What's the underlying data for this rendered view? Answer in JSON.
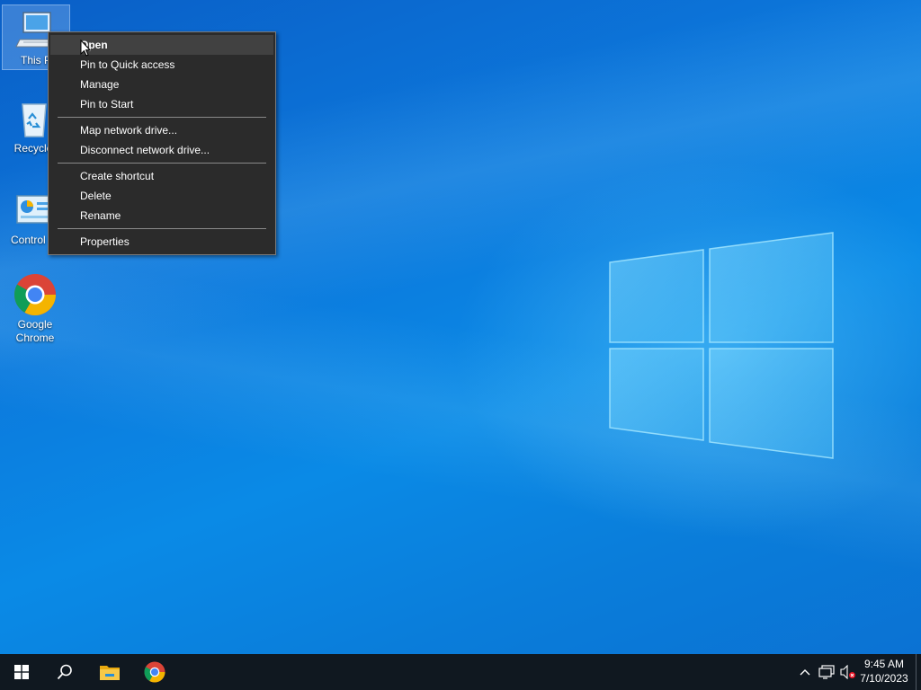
{
  "desktop": {
    "icons": [
      {
        "label": "This PC",
        "visible_label": "This P",
        "name": "this-pc"
      },
      {
        "label": "Recycle Bin",
        "visible_label": "Recycle",
        "name": "recycle-bin"
      },
      {
        "label": "Control Panel",
        "visible_label": "Control P",
        "name": "control-panel"
      },
      {
        "label": "Google Chrome",
        "line1": "Google",
        "line2": "Chrome",
        "name": "google-chrome"
      }
    ]
  },
  "context_menu": {
    "groups": [
      [
        "Open",
        "Pin to Quick access",
        "Manage",
        "Pin to Start"
      ],
      [
        "Map network drive...",
        "Disconnect network drive..."
      ],
      [
        "Create shortcut",
        "Delete",
        "Rename"
      ],
      [
        "Properties"
      ]
    ],
    "highlighted": "Open"
  },
  "taskbar": {
    "start": "windows-logo-icon",
    "search": "search-icon",
    "pinned": [
      "file-explorer-icon",
      "chrome-icon"
    ],
    "tray_icons": [
      "chevron-up-icon",
      "network-icon",
      "volume-muted-icon"
    ],
    "clock": {
      "time": "9:45 AM",
      "date": "7/10/2023"
    }
  },
  "colors": {
    "accent": "#0078d7",
    "menu_bg": "#2b2b2b",
    "taskbar_bg": "#101820"
  }
}
